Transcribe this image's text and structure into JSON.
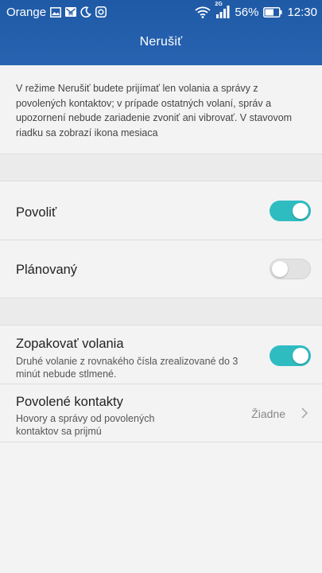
{
  "status_bar": {
    "carrier": "Orange",
    "network_type": "2G",
    "battery_percent": "56%",
    "time": "12:30",
    "icons": [
      "image-icon",
      "mail-icon",
      "moon-icon",
      "app-icon",
      "wifi-icon",
      "signal-icon",
      "battery-icon"
    ]
  },
  "header": {
    "title": "Nerušiť"
  },
  "description": "V režime Nerušiť budete prijímať len volania a správy z povolených kontaktov; v prípade ostatných volaní, správ a upozornení nebude zariadenie zvoniť ani vibrovať. V stavovom riadku sa zobrazí ikona mesiaca",
  "settings": {
    "allow": {
      "title": "Povoliť",
      "enabled": true
    },
    "scheduled": {
      "title": "Plánovaný",
      "enabled": false
    },
    "repeat_calls": {
      "title": "Zopakovať volania",
      "subtitle": "Druhé volanie z rovnakého čísla zrealizované do 3 minút nebude stlmené.",
      "enabled": true
    },
    "allowed_contacts": {
      "title": "Povolené kontakty",
      "subtitle": "Hovory a správy od povolených kontaktov sa prijmú",
      "value": "Žiadne"
    }
  },
  "colors": {
    "header_blue": "#2863b1",
    "toggle_on": "#2fbcc1",
    "toggle_off": "#e2e2e2",
    "background": "#f3f3f3"
  }
}
